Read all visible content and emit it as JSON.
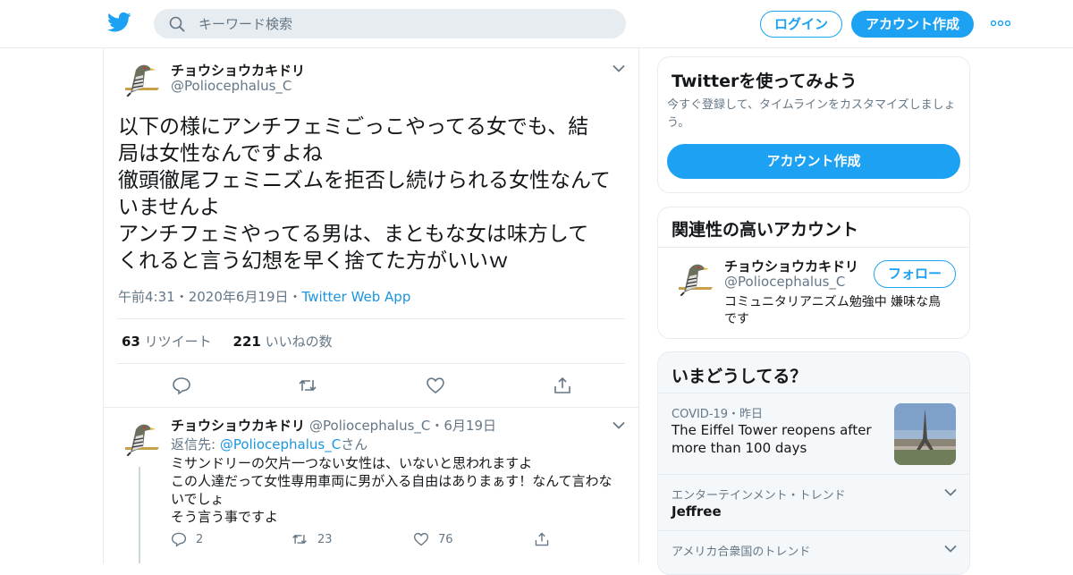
{
  "search": {
    "placeholder": "キーワード検索"
  },
  "header": {
    "login": "ログイン",
    "signup": "アカウント作成"
  },
  "tweet": {
    "name": "チョウショウカキドリ",
    "handle": "@Poliocephalus_C",
    "lines": [
      "以下の様にアンチフェミごっこやってる女でも、結",
      "局は女性なんですよね",
      "徹頭徹尾フェミニズムを拒否し続けられる女性なんて",
      "いませんよ",
      "アンチフェミやってる男は、まともな女は味方して",
      "くれると言う幻想を早く捨てた方がいいｗ"
    ],
    "time": "午前4:31",
    "date": "2020年6月19日",
    "app": "Twitter Web App",
    "sep": "・",
    "retweets": "63",
    "retweets_label": "リツイート",
    "likes": "221",
    "likes_label": "いいねの数"
  },
  "reply": {
    "name": "チョウショウカキドリ",
    "handle": "@Poliocephalus_C",
    "date": "・6月19日",
    "to_prefix": "返信先: ",
    "to_handle": "@Poliocephalus_C",
    "to_suffix": "さん",
    "lines": [
      "ミサンドリーの欠片一つない女性は、いないと思われますよ",
      "この人達だって女性専用車両に男が入る自由はありまぁす！なんて言わな",
      "いでしょ",
      "そう言う事ですよ"
    ],
    "replies": "2",
    "retweets": "23",
    "likes": "76"
  },
  "try_card": {
    "title": "Twitterを使ってみよう",
    "desc": "今すぐ登録して、タイムラインをカスタマイズしましょう。",
    "button": "アカウント作成"
  },
  "related": {
    "title": "関連性の高いアカウント",
    "name": "チョウショウカキドリ",
    "handle": "@Poliocephalus_C",
    "follow": "フォロー",
    "bio": "コミュニタリアニズム勉強中 嫌味な鳥です"
  },
  "trends": {
    "title": "いまどうしてる？",
    "items": [
      {
        "category": "COVID-19・昨日",
        "title": "The Eiffel Tower reopens after more than 100 days"
      },
      {
        "category": "エンターテインメント・トレンド",
        "title": "Jeffree"
      },
      {
        "category": "アメリカ合衆国のトレンド",
        "title": ""
      }
    ]
  },
  "colors": {
    "accent": "#1da1f2",
    "link": "#1b95e0",
    "secondary": "#657786",
    "border": "#e6ecf0"
  },
  "icons": [
    "twitter-bird-icon",
    "search-icon",
    "more-icon",
    "chevron-down-icon",
    "reply-icon",
    "retweet-icon",
    "like-icon",
    "share-icon"
  ]
}
